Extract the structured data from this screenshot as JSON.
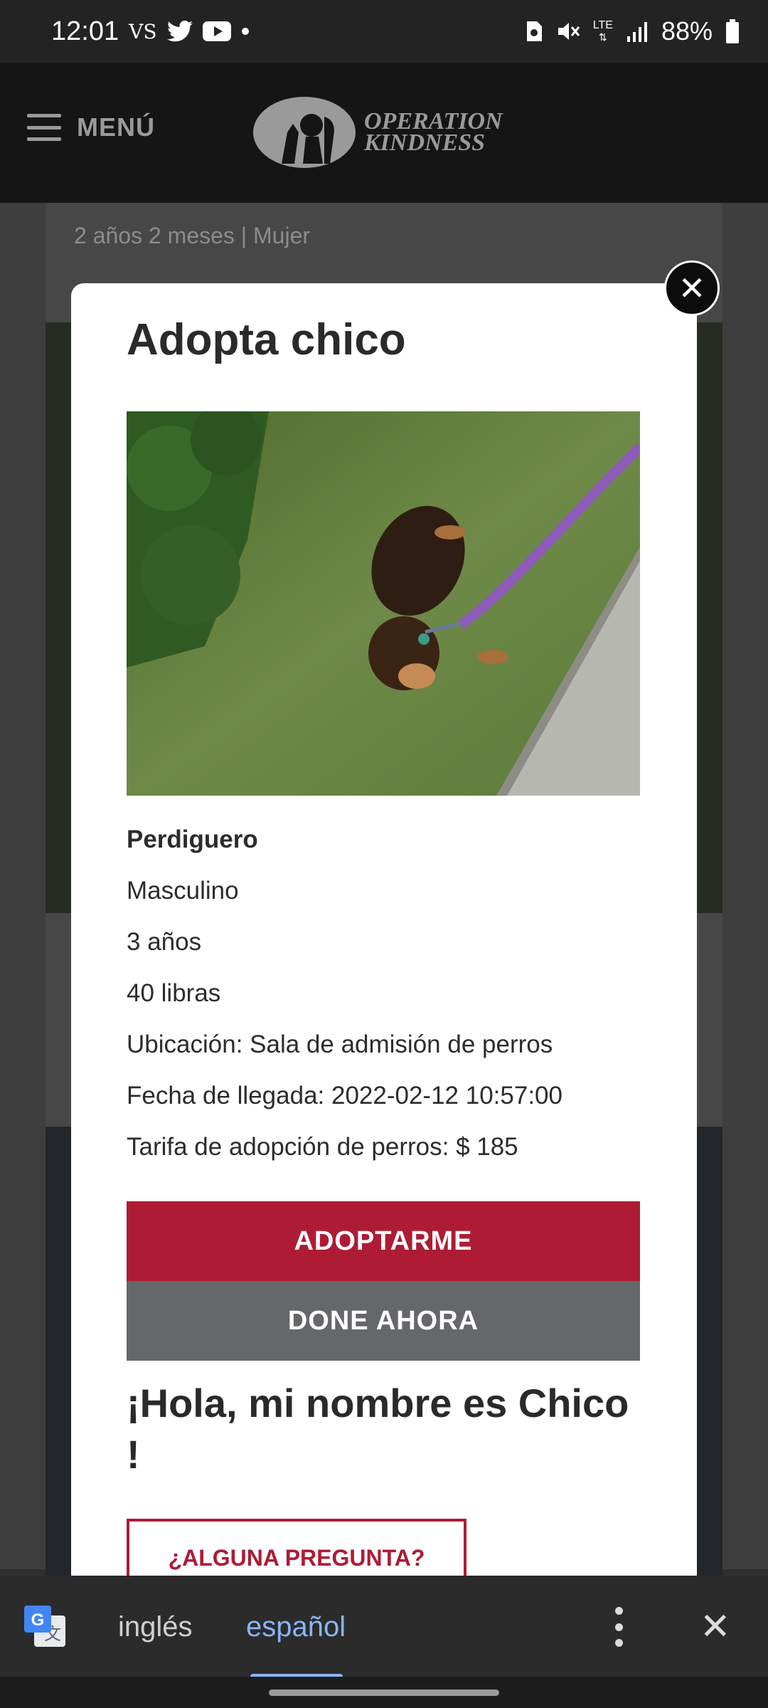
{
  "status_bar": {
    "time": "12:01",
    "carrier_badge": "VS",
    "network": "LTE",
    "battery": "88%"
  },
  "header": {
    "menu_label": "MENÚ",
    "logo_line1": "OPERATION",
    "logo_line2": "KINDNESS"
  },
  "background": {
    "subtitle": "2 años 2 meses | Mujer"
  },
  "modal": {
    "title": "Adopta chico",
    "breed": "Perdiguero",
    "sex": "Masculino",
    "age": "3 años",
    "weight": "40 libras",
    "location": "Ubicación: Sala de admisión de perros",
    "arrival": "Fecha de llegada: 2022-02-12 10:57:00",
    "fee": "Tarifa de adopción de perros: $ 185",
    "adopt_button": "ADOPTARME",
    "donate_button": "DONE AHORA",
    "greeting": "¡Hola, mi nombre es Chico !",
    "question_button": "¿ALGUNA PREGUNTA?"
  },
  "translate_bar": {
    "source_lang": "inglés",
    "target_lang": "español"
  },
  "colors": {
    "accent_red": "#ad1c34",
    "button_gray": "#65676a",
    "translate_blue": "#8ab4f8"
  }
}
